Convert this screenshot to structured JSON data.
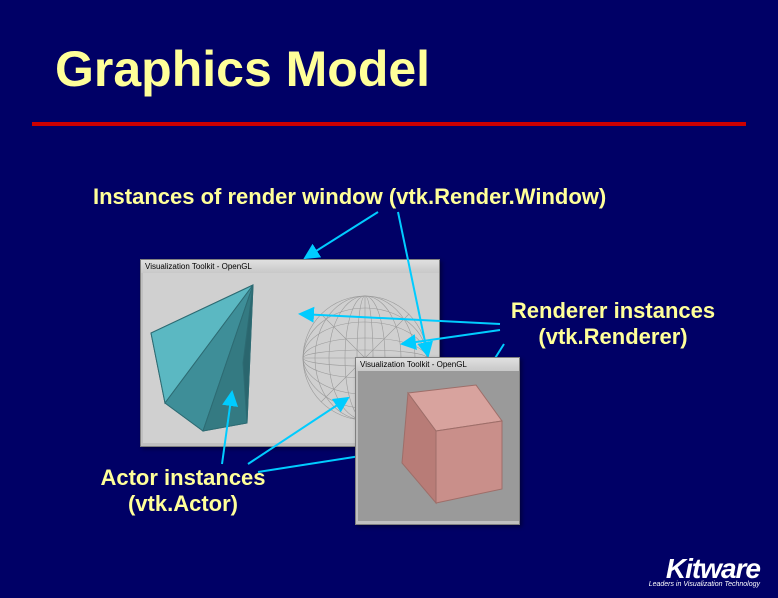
{
  "slide": {
    "title": "Graphics Model",
    "label_renderwindow": "Instances of render window (vtk.Render.Window)",
    "label_renderer_line1": "Renderer instances",
    "label_renderer_line2": "(vtk.Renderer)",
    "label_actor_line1": "Actor instances",
    "label_actor_line2": "(vtk.Actor)"
  },
  "windows": {
    "win1_title": "Visualization Toolkit - OpenGL",
    "win2_title": "Visualization Toolkit - OpenGL"
  },
  "logo": {
    "main": "Kitware",
    "sub": "Leaders in Visualization Technology"
  },
  "colors": {
    "bg": "#000066",
    "title": "#ffff99",
    "underline": "#cc0000",
    "cone": "#4aa6b0",
    "cube": "#c98f8a",
    "arrow": "#00ccff"
  }
}
